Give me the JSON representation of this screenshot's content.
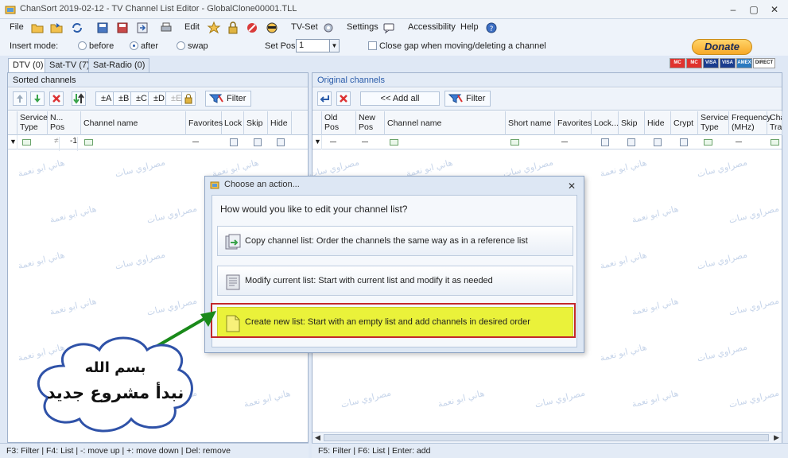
{
  "window": {
    "title": "ChanSort 2019-02-12 - TV Channel List Editor  - GlobalClone00001.TLL",
    "controls": {
      "minimize": "–",
      "maximize": "▢",
      "close": "✕"
    }
  },
  "menu": {
    "file": "File",
    "edit": "Edit",
    "tvset": "TV-Set",
    "settings": "Settings",
    "accessibility": "Accessibility",
    "help": "Help"
  },
  "options": {
    "insert_mode_label": "Insert mode:",
    "before": "before",
    "after": "after",
    "swap": "swap",
    "selected_mode": "after",
    "set_pos_label": "Set Pos:",
    "set_pos_value": "1",
    "close_gap_label": "Close gap when moving/deleting a channel",
    "close_gap_checked": false
  },
  "donate": {
    "label": "Donate",
    "cards": [
      "MC",
      "MC",
      "VISA",
      "VISA",
      "AMEX",
      "DIRECT"
    ]
  },
  "tabs": [
    {
      "label": "DTV (0)",
      "active": true
    },
    {
      "label": "Sat-TV (7)",
      "active": false
    },
    {
      "label": "Sat-Radio (0)",
      "active": false
    }
  ],
  "left_panel": {
    "title": "Sorted channels",
    "toolbar": {
      "a": "±A",
      "b": "±B",
      "c": "±C",
      "d": "±D",
      "e": "±E",
      "filter": "Filter"
    },
    "columns": [
      {
        "label": "Service Type"
      },
      {
        "label": "N... Pos"
      },
      {
        "label": "Channel name"
      },
      {
        "label": "Favorites"
      },
      {
        "label": "Lock"
      },
      {
        "label": "Skip"
      },
      {
        "label": "Hide"
      }
    ],
    "filter_row": {
      "pos_value": "-1",
      "ne_symbol": "≠"
    },
    "status": "F3: Filter | F4: List | -: move up | +: move down | Del: remove"
  },
  "right_panel": {
    "title": "Original channels",
    "toolbar": {
      "add_all": "<< Add all",
      "filter": "Filter"
    },
    "columns": [
      {
        "label": "Old Pos"
      },
      {
        "label": "New Pos"
      },
      {
        "label": "Channel name"
      },
      {
        "label": "Short name"
      },
      {
        "label": "Favorites"
      },
      {
        "label": "Lock..."
      },
      {
        "label": "Skip"
      },
      {
        "label": "Hide"
      },
      {
        "label": "Crypt"
      },
      {
        "label": "Service Type"
      },
      {
        "label": "Frequency (MHz)"
      },
      {
        "label": "Cha Tran"
      }
    ],
    "status": "F5: Filter | F6: List | Enter: add"
  },
  "dialog": {
    "title": "Choose an action...",
    "question": "How would you like to edit your channel list?",
    "actions": [
      {
        "label": "Copy channel list: Order the channels the same way as in a reference list",
        "icon": "copy-list-icon"
      },
      {
        "label": "Modify current list: Start with current list and modify it as needed",
        "icon": "modify-list-icon"
      },
      {
        "label": "Create new list: Start with an empty list and add channels in desired order",
        "icon": "new-list-icon",
        "highlighted": true
      }
    ]
  },
  "annotation": {
    "line1": "بسم الله",
    "line2": "نبدأ مشروع جديد",
    "arrow_color": "#1a8a1a"
  },
  "watermark": {
    "line1": "هاني ابو نعمة",
    "line2": "مصراوي سات"
  },
  "colors": {
    "accent": "#2a5caa",
    "highlight": "#eaf23a",
    "highlight_frame": "#c3282b",
    "donate": "#f7a928"
  }
}
